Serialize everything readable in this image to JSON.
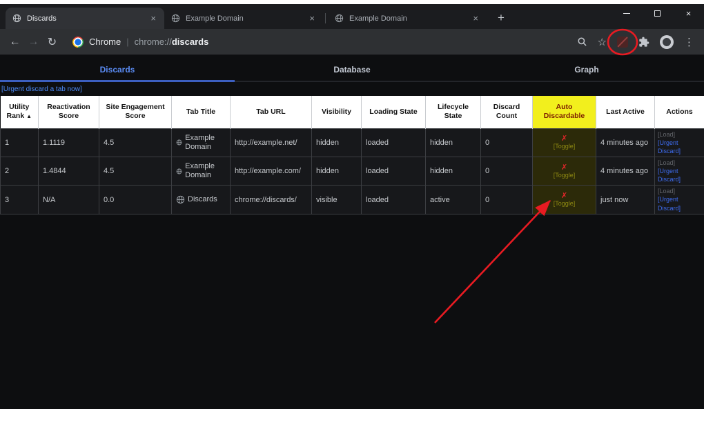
{
  "browser": {
    "tabs": [
      {
        "title": "Discards"
      },
      {
        "title": "Example Domain"
      },
      {
        "title": "Example Domain"
      }
    ]
  },
  "toolbar": {
    "product_label": "Chrome",
    "separator": "|",
    "url_scheme": "chrome://",
    "url_host": "discards"
  },
  "icons": {
    "back": "←",
    "forward": "→",
    "reload": "↻",
    "tab_close": "×",
    "new_tab": "+",
    "window_close": "×",
    "star": "☆",
    "menu": "⋮",
    "sort_asc": "▲"
  },
  "page": {
    "nav": [
      {
        "label": "Discards"
      },
      {
        "label": "Database"
      },
      {
        "label": "Graph"
      }
    ],
    "urgent_link": "[Urgent discard a tab now]",
    "table": {
      "headers": [
        "Utility Rank",
        "Reactivation Score",
        "Site Engagement Score",
        "Tab Title",
        "Tab URL",
        "Visibility",
        "Loading State",
        "Lifecycle State",
        "Discard Count",
        "Auto Discardable",
        "Last Active",
        "Actions"
      ],
      "rows": [
        {
          "rank": "1",
          "reactivation": "1.1119",
          "engagement": "4.5",
          "title": "Example Domain",
          "url": "http://example.net/",
          "visibility": "hidden",
          "loading": "loaded",
          "lifecycle": "hidden",
          "discard_count": "0",
          "auto_mark": "✗",
          "toggle": "[Toggle]",
          "last_active": "4 minutes ago",
          "load": "[Load]",
          "urgent": "[Urgent Discard]"
        },
        {
          "rank": "2",
          "reactivation": "1.4844",
          "engagement": "4.5",
          "title": "Example Domain",
          "url": "http://example.com/",
          "visibility": "hidden",
          "loading": "loaded",
          "lifecycle": "hidden",
          "discard_count": "0",
          "auto_mark": "✗",
          "toggle": "[Toggle]",
          "last_active": "4 minutes ago",
          "load": "[Load]",
          "urgent": "[Urgent Discard]"
        },
        {
          "rank": "3",
          "reactivation": "N/A",
          "engagement": "0.0",
          "title": "Discards",
          "url": "chrome://discards/",
          "visibility": "visible",
          "loading": "loaded",
          "lifecycle": "active",
          "discard_count": "0",
          "auto_mark": "✗",
          "toggle": "[Toggle]",
          "last_active": "just now",
          "load": "[Load]",
          "urgent": "[Urgent Discard]"
        }
      ]
    }
  },
  "colors": {
    "accent_blue": "#5b8df6",
    "highlight_yellow": "#f2ef1d",
    "annotation_red": "#e81b22"
  }
}
